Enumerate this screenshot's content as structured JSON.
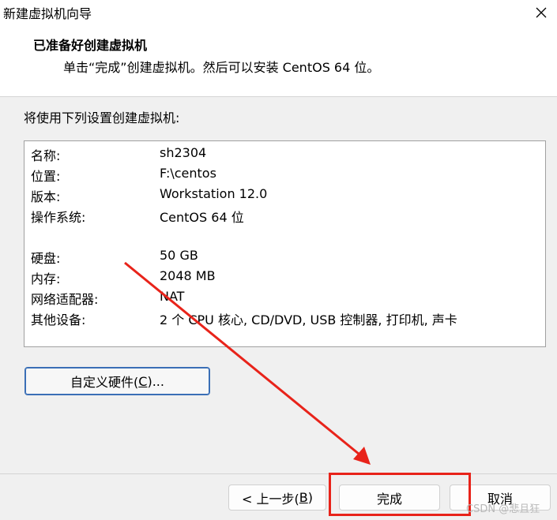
{
  "window": {
    "title": "新建虚拟机向导"
  },
  "header": {
    "title": "已准备好创建虚拟机",
    "subtitle": "单击“完成”创建虚拟机。然后可以安装 CentOS 64 位。"
  },
  "main": {
    "section_label": "将使用下列设置创建虚拟机:",
    "summary": [
      {
        "label": "名称:",
        "value": "sh2304"
      },
      {
        "label": "位置:",
        "value": "F:\\centos"
      },
      {
        "label": "版本:",
        "value": "Workstation 12.0"
      },
      {
        "label": "操作系统:",
        "value": "CentOS 64 位"
      },
      {
        "label": "硬盘:",
        "value": "50 GB"
      },
      {
        "label": "内存:",
        "value": "2048 MB"
      },
      {
        "label": "网络适配器:",
        "value": "NAT"
      },
      {
        "label": "其他设备:",
        "value": "2 个 CPU 核心, CD/DVD, USB 控制器, 打印机, 声卡"
      }
    ],
    "customize_button": {
      "pre": "自定义硬件(",
      "key": "C",
      "post": ")..."
    }
  },
  "footer": {
    "back_button": {
      "pre": "< 上一步(",
      "key": "B",
      "post": ")"
    },
    "finish_label": "完成",
    "cancel_label": "取消"
  },
  "watermark": "CSDN @悲且狂",
  "annotation_color": "#e8231a"
}
